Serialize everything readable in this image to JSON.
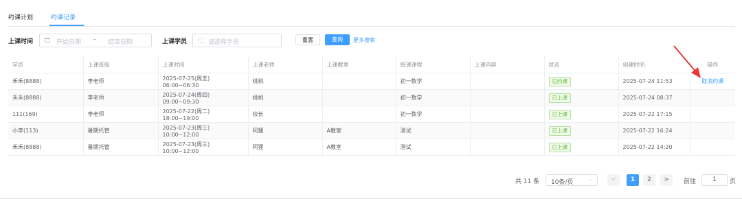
{
  "tabs": [
    {
      "label": "约课计划"
    },
    {
      "label": "约课记录"
    }
  ],
  "filters": {
    "time_label": "上课时间",
    "date_start_placeholder": "开始日期",
    "date_separator": "-",
    "date_end_placeholder": "结束日期",
    "student_label": "上课学员",
    "student_placeholder": "请选择学员",
    "reset": "重置",
    "search": "查询",
    "more": "更多搜索"
  },
  "table": {
    "headers": [
      "学员",
      "上课班级",
      "上课时间",
      "上课老师",
      "上课教室",
      "授课课程",
      "上课内容",
      "状态",
      "创建时间",
      "操作"
    ],
    "rows": [
      {
        "student": "禾禾(8888)",
        "class": "李老师",
        "time": "2025-07-25(周五) 06:00~06:30",
        "teacher": "桃桃",
        "room": "",
        "course": "初一数学",
        "content": "",
        "status": "已约课",
        "created": "2025-07-24 11:53",
        "action": "取消约课"
      },
      {
        "student": "禾禾(8888)",
        "class": "李老师",
        "time": "2025-07-24(周四) 09:00~09:30",
        "teacher": "桃桃",
        "room": "",
        "course": "初一数学",
        "content": "",
        "status": "已上课",
        "created": "2025-07-24 08:37",
        "action": ""
      },
      {
        "student": "111(169)",
        "class": "李老师",
        "time": "2025-07-22(周二) 18:00~19:00",
        "teacher": "校长",
        "room": "",
        "course": "初一数学",
        "content": "",
        "status": "已上课",
        "created": "2025-07-22 17:15",
        "action": ""
      },
      {
        "student": "小李(113)",
        "class": "暑期托管",
        "time": "2025-07-23(周三) 10:00~12:00",
        "teacher": "阿狸",
        "room": "A教室",
        "course": "测试",
        "content": "",
        "status": "已上课",
        "created": "2025-07-22 16:24",
        "action": ""
      },
      {
        "student": "禾禾(8888)",
        "class": "暑期托管",
        "time": "2025-07-23(周三) 10:00~12:00",
        "teacher": "阿狸",
        "room": "A教室",
        "course": "测试",
        "content": "",
        "status": "已上课",
        "created": "2025-07-22 14:20",
        "action": ""
      }
    ]
  },
  "pagination": {
    "total": "共 11 条",
    "page_size": "10条/页",
    "prev": "<",
    "pages": [
      "1",
      "2"
    ],
    "next": ">",
    "goto_label": "前往",
    "goto_value": "1",
    "goto_suffix": "页"
  },
  "colors": {
    "accent": "#409eff",
    "success": "#67c23a",
    "arrow": "#e53935"
  }
}
